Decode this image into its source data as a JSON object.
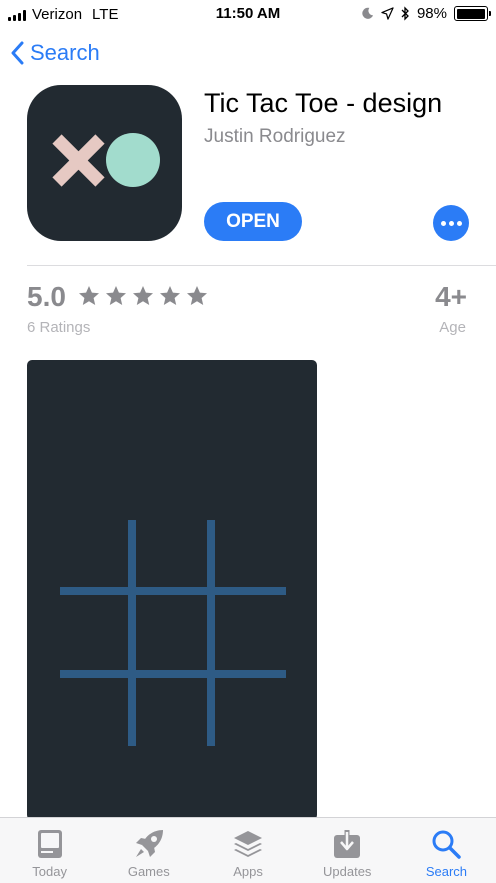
{
  "status_bar": {
    "carrier": "Verizon",
    "network": "LTE",
    "time": "11:50 AM",
    "battery_percent": "98%",
    "battery_level": 0.98,
    "icons": [
      "moon-icon",
      "location-arrow-icon",
      "bluetooth-icon",
      "battery-icon"
    ]
  },
  "nav": {
    "back_label": "Search"
  },
  "app": {
    "title": "Tic Tac Toe - design",
    "developer": "Justin Rodriguez",
    "open_label": "OPEN",
    "icon_colors": {
      "background": "#222a31",
      "x": "#e6c9c3",
      "o": "#a2dccd"
    }
  },
  "ratings": {
    "value": "5.0",
    "stars": 5,
    "count_label": "6 Ratings"
  },
  "age": {
    "value": "4+",
    "label": "Age"
  },
  "screenshot": {
    "background": "#222a31",
    "grid_color": "#2e5b85"
  },
  "colors": {
    "accent": "#2b7cf6",
    "secondary_text": "#8a8a8e",
    "tertiary_text": "#b4b4b8"
  },
  "tabs": [
    {
      "label": "Today",
      "icon": "today-icon",
      "active": false
    },
    {
      "label": "Games",
      "icon": "rocket-icon",
      "active": false
    },
    {
      "label": "Apps",
      "icon": "layers-icon",
      "active": false
    },
    {
      "label": "Updates",
      "icon": "download-icon",
      "active": false
    },
    {
      "label": "Search",
      "icon": "search-icon",
      "active": true
    }
  ]
}
